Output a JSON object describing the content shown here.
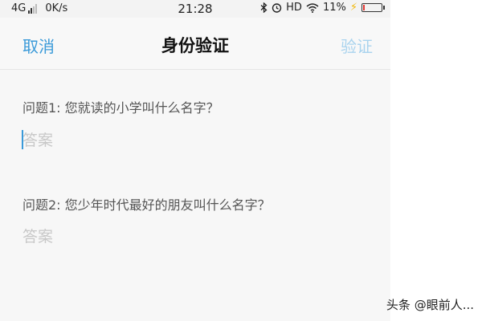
{
  "status_bar": {
    "network": "4G",
    "speed": "0K/s",
    "time": "21:28",
    "bluetooth_icon": "bluetooth-icon",
    "alarm_icon": "alarm-icon",
    "hd": "HD",
    "wifi_icon": "wifi-icon",
    "battery_percent": "11%",
    "battery_level": 0.11
  },
  "nav": {
    "cancel_label": "取消",
    "title": "身份验证",
    "verify_label": "验证",
    "accent_color": "#3a9ad9",
    "verify_disabled_color": "#a9d3ee"
  },
  "form": {
    "questions": [
      {
        "label": "问题1: 您就读的小学叫什么名字？",
        "answer_value": "",
        "answer_placeholder": "答案"
      },
      {
        "label": "问题2: 您少年时代最好的朋友叫什么名字？",
        "answer_value": "",
        "answer_placeholder": "答案"
      }
    ]
  },
  "watermark": "头条 @眼前人..."
}
